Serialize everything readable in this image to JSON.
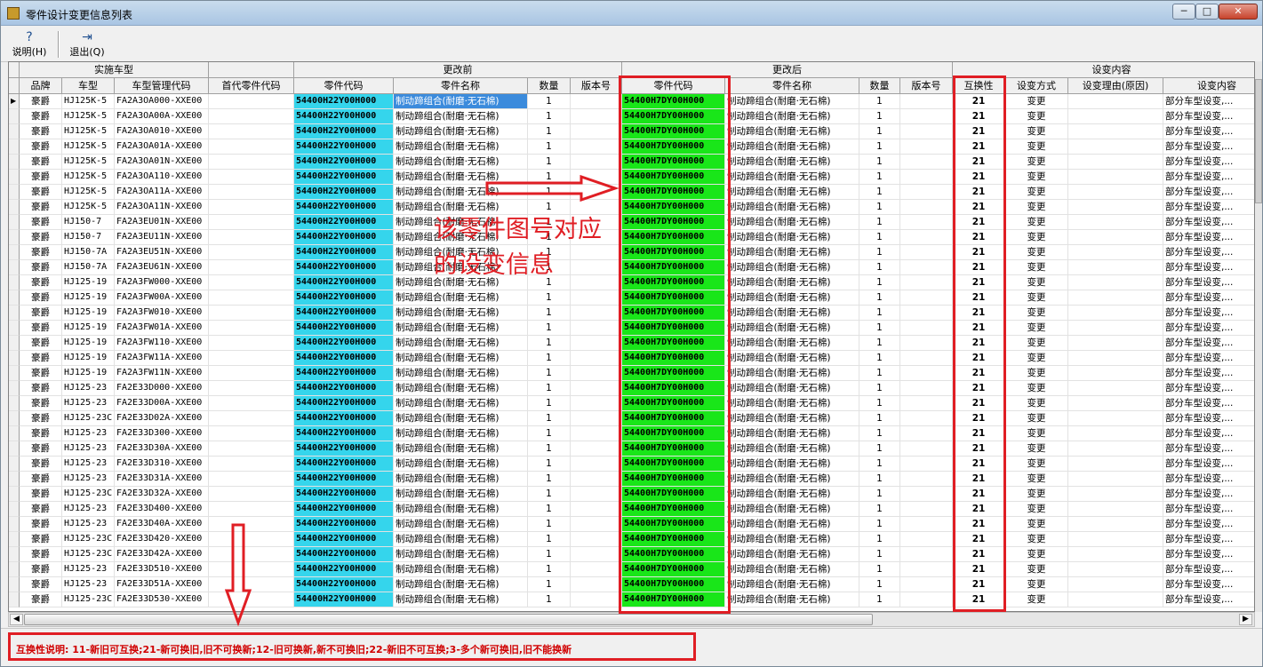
{
  "window": {
    "title": "零件设计变更信息列表",
    "controls": {
      "minimize": "─",
      "maximize": "□",
      "close": "✕"
    }
  },
  "toolbar": {
    "help": {
      "label": "说明",
      "hotkey": "(H)",
      "icon": "question-icon"
    },
    "exit": {
      "label": "退出",
      "hotkey": "(Q)",
      "icon": "exit-door-icon"
    }
  },
  "grid": {
    "group_headers": [
      {
        "name": "impl",
        "label": "实施车型"
      },
      {
        "name": "blank",
        "label": ""
      },
      {
        "name": "before",
        "label": "更改前"
      },
      {
        "name": "after",
        "label": "更改后"
      },
      {
        "name": "content",
        "label": "设变内容"
      }
    ],
    "columns": [
      "品牌",
      "车型",
      "车型管理代码",
      "首代零件代码",
      "零件代码",
      "零件名称",
      "数量",
      "版本号",
      "零件代码",
      "零件名称",
      "数量",
      "版本号",
      "互换性",
      "设变方式",
      "设变理由(原因)",
      "设变内容"
    ],
    "rows": [
      {
        "brand": "豪爵",
        "model": "HJ125K-5",
        "mgmt": "FA2A3OA000-XXE00",
        "first": "",
        "old_code": "54400H22Y00H000",
        "old_name": "制动蹄组合(耐磨·无石棉)",
        "old_qty": "1",
        "old_ver": "",
        "new_code": "54400H7DY00H000",
        "new_name": "制动蹄组合(耐磨·无石棉)",
        "new_qty": "1",
        "new_ver": "",
        "ich": "21",
        "method": "变更",
        "reason": "",
        "content": "部分车型设变,..."
      },
      {
        "brand": "豪爵",
        "model": "HJ125K-5",
        "mgmt": "FA2A3OA00A-XXE00",
        "first": "",
        "old_code": "54400H22Y00H000",
        "old_name": "制动蹄组合(耐磨·无石棉)",
        "old_qty": "1",
        "old_ver": "",
        "new_code": "54400H7DY00H000",
        "new_name": "制动蹄组合(耐磨·无石棉)",
        "new_qty": "1",
        "new_ver": "",
        "ich": "21",
        "method": "变更",
        "reason": "",
        "content": "部分车型设变,..."
      },
      {
        "brand": "豪爵",
        "model": "HJ125K-5",
        "mgmt": "FA2A3OA010-XXE00",
        "first": "",
        "old_code": "54400H22Y00H000",
        "old_name": "制动蹄组合(耐磨·无石棉)",
        "old_qty": "1",
        "old_ver": "",
        "new_code": "54400H7DY00H000",
        "new_name": "制动蹄组合(耐磨·无石棉)",
        "new_qty": "1",
        "new_ver": "",
        "ich": "21",
        "method": "变更",
        "reason": "",
        "content": "部分车型设变,..."
      },
      {
        "brand": "豪爵",
        "model": "HJ125K-5",
        "mgmt": "FA2A3OA01A-XXE00",
        "first": "",
        "old_code": "54400H22Y00H000",
        "old_name": "制动蹄组合(耐磨·无石棉)",
        "old_qty": "1",
        "old_ver": "",
        "new_code": "54400H7DY00H000",
        "new_name": "制动蹄组合(耐磨·无石棉)",
        "new_qty": "1",
        "new_ver": "",
        "ich": "21",
        "method": "变更",
        "reason": "",
        "content": "部分车型设变,..."
      },
      {
        "brand": "豪爵",
        "model": "HJ125K-5",
        "mgmt": "FA2A3OA01N-XXE00",
        "first": "",
        "old_code": "54400H22Y00H000",
        "old_name": "制动蹄组合(耐磨·无石棉)",
        "old_qty": "1",
        "old_ver": "",
        "new_code": "54400H7DY00H000",
        "new_name": "制动蹄组合(耐磨·无石棉)",
        "new_qty": "1",
        "new_ver": "",
        "ich": "21",
        "method": "变更",
        "reason": "",
        "content": "部分车型设变,..."
      },
      {
        "brand": "豪爵",
        "model": "HJ125K-5",
        "mgmt": "FA2A3OA110-XXE00",
        "first": "",
        "old_code": "54400H22Y00H000",
        "old_name": "制动蹄组合(耐磨·无石棉)",
        "old_qty": "1",
        "old_ver": "",
        "new_code": "54400H7DY00H000",
        "new_name": "制动蹄组合(耐磨·无石棉)",
        "new_qty": "1",
        "new_ver": "",
        "ich": "21",
        "method": "变更",
        "reason": "",
        "content": "部分车型设变,..."
      },
      {
        "brand": "豪爵",
        "model": "HJ125K-5",
        "mgmt": "FA2A3OA11A-XXE00",
        "first": "",
        "old_code": "54400H22Y00H000",
        "old_name": "制动蹄组合(耐磨·无石棉)",
        "old_qty": "1",
        "old_ver": "",
        "new_code": "54400H7DY00H000",
        "new_name": "制动蹄组合(耐磨·无石棉)",
        "new_qty": "1",
        "new_ver": "",
        "ich": "21",
        "method": "变更",
        "reason": "",
        "content": "部分车型设变,..."
      },
      {
        "brand": "豪爵",
        "model": "HJ125K-5",
        "mgmt": "FA2A3OA11N-XXE00",
        "first": "",
        "old_code": "54400H22Y00H000",
        "old_name": "制动蹄组合(耐磨·无石棉)",
        "old_qty": "1",
        "old_ver": "",
        "new_code": "54400H7DY00H000",
        "new_name": "制动蹄组合(耐磨·无石棉)",
        "new_qty": "1",
        "new_ver": "",
        "ich": "21",
        "method": "变更",
        "reason": "",
        "content": "部分车型设变,..."
      },
      {
        "brand": "豪爵",
        "model": "HJ150-7",
        "mgmt": "FA2A3EU01N-XXE00",
        "first": "",
        "old_code": "54400H22Y00H000",
        "old_name": "制动蹄组合(耐磨·无石棉)",
        "old_qty": "1",
        "old_ver": "",
        "new_code": "54400H7DY00H000",
        "new_name": "制动蹄组合(耐磨·无石棉)",
        "new_qty": "1",
        "new_ver": "",
        "ich": "21",
        "method": "变更",
        "reason": "",
        "content": "部分车型设变,..."
      },
      {
        "brand": "豪爵",
        "model": "HJ150-7",
        "mgmt": "FA2A3EU11N-XXE00",
        "first": "",
        "old_code": "54400H22Y00H000",
        "old_name": "制动蹄组合(耐磨·无石棉)",
        "old_qty": "1",
        "old_ver": "",
        "new_code": "54400H7DY00H000",
        "new_name": "制动蹄组合(耐磨·无石棉)",
        "new_qty": "1",
        "new_ver": "",
        "ich": "21",
        "method": "变更",
        "reason": "",
        "content": "部分车型设变,..."
      },
      {
        "brand": "豪爵",
        "model": "HJ150-7A",
        "mgmt": "FA2A3EU51N-XXE00",
        "first": "",
        "old_code": "54400H22Y00H000",
        "old_name": "制动蹄组合(耐磨·无石棉)",
        "old_qty": "1",
        "old_ver": "",
        "new_code": "54400H7DY00H000",
        "new_name": "制动蹄组合(耐磨·无石棉)",
        "new_qty": "1",
        "new_ver": "",
        "ich": "21",
        "method": "变更",
        "reason": "",
        "content": "部分车型设变,..."
      },
      {
        "brand": "豪爵",
        "model": "HJ150-7A",
        "mgmt": "FA2A3EU61N-XXE00",
        "first": "",
        "old_code": "54400H22Y00H000",
        "old_name": "制动蹄组合(耐磨·无石棉)",
        "old_qty": "1",
        "old_ver": "",
        "new_code": "54400H7DY00H000",
        "new_name": "制动蹄组合(耐磨·无石棉)",
        "new_qty": "1",
        "new_ver": "",
        "ich": "21",
        "method": "变更",
        "reason": "",
        "content": "部分车型设变,..."
      },
      {
        "brand": "豪爵",
        "model": "HJ125-19",
        "mgmt": "FA2A3FW000-XXE00",
        "first": "",
        "old_code": "54400H22Y00H000",
        "old_name": "制动蹄组合(耐磨·无石棉)",
        "old_qty": "1",
        "old_ver": "",
        "new_code": "54400H7DY00H000",
        "new_name": "制动蹄组合(耐磨·无石棉)",
        "new_qty": "1",
        "new_ver": "",
        "ich": "21",
        "method": "变更",
        "reason": "",
        "content": "部分车型设变,..."
      },
      {
        "brand": "豪爵",
        "model": "HJ125-19",
        "mgmt": "FA2A3FW00A-XXE00",
        "first": "",
        "old_code": "54400H22Y00H000",
        "old_name": "制动蹄组合(耐磨·无石棉)",
        "old_qty": "1",
        "old_ver": "",
        "new_code": "54400H7DY00H000",
        "new_name": "制动蹄组合(耐磨·无石棉)",
        "new_qty": "1",
        "new_ver": "",
        "ich": "21",
        "method": "变更",
        "reason": "",
        "content": "部分车型设变,..."
      },
      {
        "brand": "豪爵",
        "model": "HJ125-19",
        "mgmt": "FA2A3FW010-XXE00",
        "first": "",
        "old_code": "54400H22Y00H000",
        "old_name": "制动蹄组合(耐磨·无石棉)",
        "old_qty": "1",
        "old_ver": "",
        "new_code": "54400H7DY00H000",
        "new_name": "制动蹄组合(耐磨·无石棉)",
        "new_qty": "1",
        "new_ver": "",
        "ich": "21",
        "method": "变更",
        "reason": "",
        "content": "部分车型设变,..."
      },
      {
        "brand": "豪爵",
        "model": "HJ125-19",
        "mgmt": "FA2A3FW01A-XXE00",
        "first": "",
        "old_code": "54400H22Y00H000",
        "old_name": "制动蹄组合(耐磨·无石棉)",
        "old_qty": "1",
        "old_ver": "",
        "new_code": "54400H7DY00H000",
        "new_name": "制动蹄组合(耐磨·无石棉)",
        "new_qty": "1",
        "new_ver": "",
        "ich": "21",
        "method": "变更",
        "reason": "",
        "content": "部分车型设变,..."
      },
      {
        "brand": "豪爵",
        "model": "HJ125-19",
        "mgmt": "FA2A3FW110-XXE00",
        "first": "",
        "old_code": "54400H22Y00H000",
        "old_name": "制动蹄组合(耐磨·无石棉)",
        "old_qty": "1",
        "old_ver": "",
        "new_code": "54400H7DY00H000",
        "new_name": "制动蹄组合(耐磨·无石棉)",
        "new_qty": "1",
        "new_ver": "",
        "ich": "21",
        "method": "变更",
        "reason": "",
        "content": "部分车型设变,..."
      },
      {
        "brand": "豪爵",
        "model": "HJ125-19",
        "mgmt": "FA2A3FW11A-XXE00",
        "first": "",
        "old_code": "54400H22Y00H000",
        "old_name": "制动蹄组合(耐磨·无石棉)",
        "old_qty": "1",
        "old_ver": "",
        "new_code": "54400H7DY00H000",
        "new_name": "制动蹄组合(耐磨·无石棉)",
        "new_qty": "1",
        "new_ver": "",
        "ich": "21",
        "method": "变更",
        "reason": "",
        "content": "部分车型设变,..."
      },
      {
        "brand": "豪爵",
        "model": "HJ125-19",
        "mgmt": "FA2A3FW11N-XXE00",
        "first": "",
        "old_code": "54400H22Y00H000",
        "old_name": "制动蹄组合(耐磨·无石棉)",
        "old_qty": "1",
        "old_ver": "",
        "new_code": "54400H7DY00H000",
        "new_name": "制动蹄组合(耐磨·无石棉)",
        "new_qty": "1",
        "new_ver": "",
        "ich": "21",
        "method": "变更",
        "reason": "",
        "content": "部分车型设变,..."
      },
      {
        "brand": "豪爵",
        "model": "HJ125-23",
        "mgmt": "FA2E33D000-XXE00",
        "first": "",
        "old_code": "54400H22Y00H000",
        "old_name": "制动蹄组合(耐磨·无石棉)",
        "old_qty": "1",
        "old_ver": "",
        "new_code": "54400H7DY00H000",
        "new_name": "制动蹄组合(耐磨·无石棉)",
        "new_qty": "1",
        "new_ver": "",
        "ich": "21",
        "method": "变更",
        "reason": "",
        "content": "部分车型设变,..."
      },
      {
        "brand": "豪爵",
        "model": "HJ125-23",
        "mgmt": "FA2E33D00A-XXE00",
        "first": "",
        "old_code": "54400H22Y00H000",
        "old_name": "制动蹄组合(耐磨·无石棉)",
        "old_qty": "1",
        "old_ver": "",
        "new_code": "54400H7DY00H000",
        "new_name": "制动蹄组合(耐磨·无石棉)",
        "new_qty": "1",
        "new_ver": "",
        "ich": "21",
        "method": "变更",
        "reason": "",
        "content": "部分车型设变,..."
      },
      {
        "brand": "豪爵",
        "model": "HJ125-23C",
        "mgmt": "FA2E33D02A-XXE00",
        "first": "",
        "old_code": "54400H22Y00H000",
        "old_name": "制动蹄组合(耐磨·无石棉)",
        "old_qty": "1",
        "old_ver": "",
        "new_code": "54400H7DY00H000",
        "new_name": "制动蹄组合(耐磨·无石棉)",
        "new_qty": "1",
        "new_ver": "",
        "ich": "21",
        "method": "变更",
        "reason": "",
        "content": "部分车型设变,..."
      },
      {
        "brand": "豪爵",
        "model": "HJ125-23",
        "mgmt": "FA2E33D300-XXE00",
        "first": "",
        "old_code": "54400H22Y00H000",
        "old_name": "制动蹄组合(耐磨·无石棉)",
        "old_qty": "1",
        "old_ver": "",
        "new_code": "54400H7DY00H000",
        "new_name": "制动蹄组合(耐磨·无石棉)",
        "new_qty": "1",
        "new_ver": "",
        "ich": "21",
        "method": "变更",
        "reason": "",
        "content": "部分车型设变,..."
      },
      {
        "brand": "豪爵",
        "model": "HJ125-23",
        "mgmt": "FA2E33D30A-XXE00",
        "first": "",
        "old_code": "54400H22Y00H000",
        "old_name": "制动蹄组合(耐磨·无石棉)",
        "old_qty": "1",
        "old_ver": "",
        "new_code": "54400H7DY00H000",
        "new_name": "制动蹄组合(耐磨·无石棉)",
        "new_qty": "1",
        "new_ver": "",
        "ich": "21",
        "method": "变更",
        "reason": "",
        "content": "部分车型设变,..."
      },
      {
        "brand": "豪爵",
        "model": "HJ125-23",
        "mgmt": "FA2E33D310-XXE00",
        "first": "",
        "old_code": "54400H22Y00H000",
        "old_name": "制动蹄组合(耐磨·无石棉)",
        "old_qty": "1",
        "old_ver": "",
        "new_code": "54400H7DY00H000",
        "new_name": "制动蹄组合(耐磨·无石棉)",
        "new_qty": "1",
        "new_ver": "",
        "ich": "21",
        "method": "变更",
        "reason": "",
        "content": "部分车型设变,..."
      },
      {
        "brand": "豪爵",
        "model": "HJ125-23",
        "mgmt": "FA2E33D31A-XXE00",
        "first": "",
        "old_code": "54400H22Y00H000",
        "old_name": "制动蹄组合(耐磨·无石棉)",
        "old_qty": "1",
        "old_ver": "",
        "new_code": "54400H7DY00H000",
        "new_name": "制动蹄组合(耐磨·无石棉)",
        "new_qty": "1",
        "new_ver": "",
        "ich": "21",
        "method": "变更",
        "reason": "",
        "content": "部分车型设变,..."
      },
      {
        "brand": "豪爵",
        "model": "HJ125-23C",
        "mgmt": "FA2E33D32A-XXE00",
        "first": "",
        "old_code": "54400H22Y00H000",
        "old_name": "制动蹄组合(耐磨·无石棉)",
        "old_qty": "1",
        "old_ver": "",
        "new_code": "54400H7DY00H000",
        "new_name": "制动蹄组合(耐磨·无石棉)",
        "new_qty": "1",
        "new_ver": "",
        "ich": "21",
        "method": "变更",
        "reason": "",
        "content": "部分车型设变,..."
      },
      {
        "brand": "豪爵",
        "model": "HJ125-23",
        "mgmt": "FA2E33D400-XXE00",
        "first": "",
        "old_code": "54400H22Y00H000",
        "old_name": "制动蹄组合(耐磨·无石棉)",
        "old_qty": "1",
        "old_ver": "",
        "new_code": "54400H7DY00H000",
        "new_name": "制动蹄组合(耐磨·无石棉)",
        "new_qty": "1",
        "new_ver": "",
        "ich": "21",
        "method": "变更",
        "reason": "",
        "content": "部分车型设变,..."
      },
      {
        "brand": "豪爵",
        "model": "HJ125-23",
        "mgmt": "FA2E33D40A-XXE00",
        "first": "",
        "old_code": "54400H22Y00H000",
        "old_name": "制动蹄组合(耐磨·无石棉)",
        "old_qty": "1",
        "old_ver": "",
        "new_code": "54400H7DY00H000",
        "new_name": "制动蹄组合(耐磨·无石棉)",
        "new_qty": "1",
        "new_ver": "",
        "ich": "21",
        "method": "变更",
        "reason": "",
        "content": "部分车型设变,..."
      },
      {
        "brand": "豪爵",
        "model": "HJ125-23C",
        "mgmt": "FA2E33D420-XXE00",
        "first": "",
        "old_code": "54400H22Y00H000",
        "old_name": "制动蹄组合(耐磨·无石棉)",
        "old_qty": "1",
        "old_ver": "",
        "new_code": "54400H7DY00H000",
        "new_name": "制动蹄组合(耐磨·无石棉)",
        "new_qty": "1",
        "new_ver": "",
        "ich": "21",
        "method": "变更",
        "reason": "",
        "content": "部分车型设变,..."
      },
      {
        "brand": "豪爵",
        "model": "HJ125-23C",
        "mgmt": "FA2E33D42A-XXE00",
        "first": "",
        "old_code": "54400H22Y00H000",
        "old_name": "制动蹄组合(耐磨·无石棉)",
        "old_qty": "1",
        "old_ver": "",
        "new_code": "54400H7DY00H000",
        "new_name": "制动蹄组合(耐磨·无石棉)",
        "new_qty": "1",
        "new_ver": "",
        "ich": "21",
        "method": "变更",
        "reason": "",
        "content": "部分车型设变,..."
      },
      {
        "brand": "豪爵",
        "model": "HJ125-23",
        "mgmt": "FA2E33D510-XXE00",
        "first": "",
        "old_code": "54400H22Y00H000",
        "old_name": "制动蹄组合(耐磨·无石棉)",
        "old_qty": "1",
        "old_ver": "",
        "new_code": "54400H7DY00H000",
        "new_name": "制动蹄组合(耐磨·无石棉)",
        "new_qty": "1",
        "new_ver": "",
        "ich": "21",
        "method": "变更",
        "reason": "",
        "content": "部分车型设变,..."
      },
      {
        "brand": "豪爵",
        "model": "HJ125-23",
        "mgmt": "FA2E33D51A-XXE00",
        "first": "",
        "old_code": "54400H22Y00H000",
        "old_name": "制动蹄组合(耐磨·无石棉)",
        "old_qty": "1",
        "old_ver": "",
        "new_code": "54400H7DY00H000",
        "new_name": "制动蹄组合(耐磨·无石棉)",
        "new_qty": "1",
        "new_ver": "",
        "ich": "21",
        "method": "变更",
        "reason": "",
        "content": "部分车型设变,..."
      },
      {
        "brand": "豪爵",
        "model": "HJ125-23C",
        "mgmt": "FA2E33D530-XXE00",
        "first": "",
        "old_code": "54400H22Y00H000",
        "old_name": "制动蹄组合(耐磨·无石棉)",
        "old_qty": "1",
        "old_ver": "",
        "new_code": "54400H7DY00H000",
        "new_name": "制动蹄组合(耐磨·无石棉)",
        "new_qty": "1",
        "new_ver": "",
        "ich": "21",
        "method": "变更",
        "reason": "",
        "content": "部分车型设变,..."
      }
    ],
    "selected_row": 0,
    "row_indicator": "▶"
  },
  "annotation": {
    "note": "该零件图号对应的设变信息",
    "color": "#e01e24"
  },
  "status": {
    "legend": "互换性说明: 11-新旧可互换;21-新可换旧,旧不可换新;12-旧可换新,新不可换旧;22-新旧不可互换;3-多个新可换旧,旧不能换新"
  },
  "colors": {
    "old_code_bg": "#35d5ec",
    "new_code_bg": "#19e619",
    "selection_bg": "#3b8bdc",
    "annotation_red": "#e01e24"
  }
}
